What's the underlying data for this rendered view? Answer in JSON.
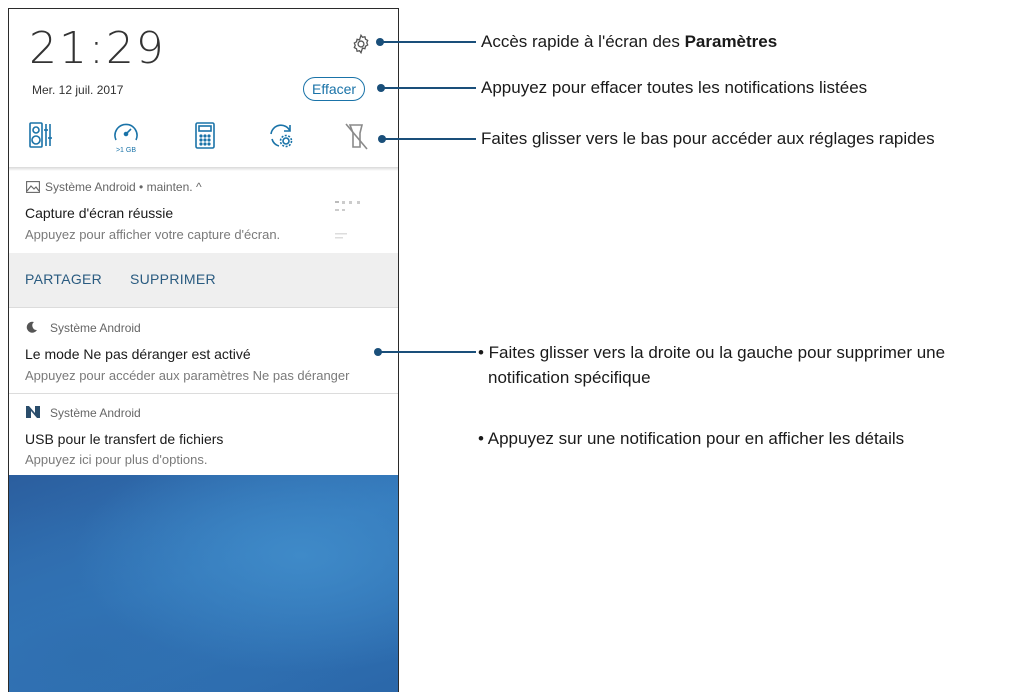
{
  "status": {
    "time": "21:29",
    "date": "Mer. 12 juil. 2017",
    "clear_button": "Effacer"
  },
  "quick_settings": [
    {
      "icon": "equalizer-icon"
    },
    {
      "icon": "speed-boost-icon",
      "caption": ">1 GB"
    },
    {
      "icon": "calculator-icon"
    },
    {
      "icon": "settings-rotate-icon"
    },
    {
      "icon": "flashlight-off-icon"
    }
  ],
  "notifications": [
    {
      "app": "Système Android • mainten. ^",
      "title": "Capture d'écran réussie",
      "subtitle": "Appuyez pour afficher votre capture d'écran.",
      "actions": [
        "PARTAGER",
        "SUPPRIMER"
      ]
    },
    {
      "app": "Système Android",
      "title": "Le mode Ne pas déranger est activé",
      "subtitle": "Appuyez pour accéder aux paramètres Ne pas déranger"
    },
    {
      "app": "Système Android",
      "title": "USB pour le transfert de fichiers",
      "subtitle": "Appuyez ici pour plus d'options."
    }
  ],
  "callouts": {
    "settings_prefix": "Accès rapide à l'écran des ",
    "settings_bold": "Paramètres",
    "clear": "Appuyez pour effacer toutes les notifications listées",
    "quick": "Faites glisser vers le bas pour accéder aux réglages rapides",
    "swipe_line1": "• Faites glisser vers la droite ou la gauche pour supprimer une",
    "swipe_line2": "notification spécifique",
    "tap": "• Appuyez sur une notification pour en afficher les détails"
  },
  "colors": {
    "accent": "#1a73a8",
    "callout_line": "#1a4f7a",
    "wallpaper": "#2f6fb0"
  }
}
